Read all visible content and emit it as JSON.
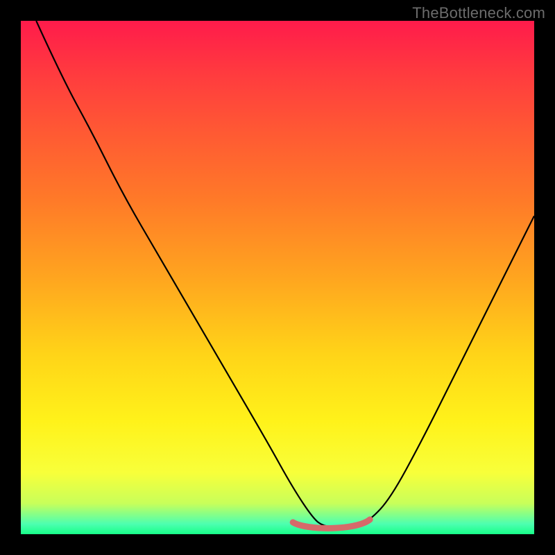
{
  "watermark": {
    "text": "TheBottleneck.com"
  },
  "colors": {
    "background": "#000000",
    "gradient_top": "#ff1b4b",
    "gradient_bottom": "#17ff88",
    "curve": "#000000",
    "highlight": "#d66a6a"
  },
  "chart_data": {
    "type": "line",
    "title": "",
    "xlabel": "",
    "ylabel": "",
    "xlim": [
      0,
      100
    ],
    "ylim": [
      0,
      100
    ],
    "grid": false,
    "series": [
      {
        "name": "bottleneck-curve",
        "x": [
          3,
          8,
          14,
          20,
          27,
          34,
          41,
          48,
          53,
          57,
          59,
          62,
          65,
          68,
          72,
          78,
          85,
          92,
          100
        ],
        "y": [
          100,
          89,
          78,
          66,
          54,
          42,
          30,
          18,
          9,
          3,
          1.5,
          1.5,
          1.5,
          2.7,
          7,
          18,
          32,
          46,
          62
        ]
      }
    ],
    "highlight_range": {
      "x_start": 53,
      "x_end": 68,
      "y": 1.5
    }
  }
}
